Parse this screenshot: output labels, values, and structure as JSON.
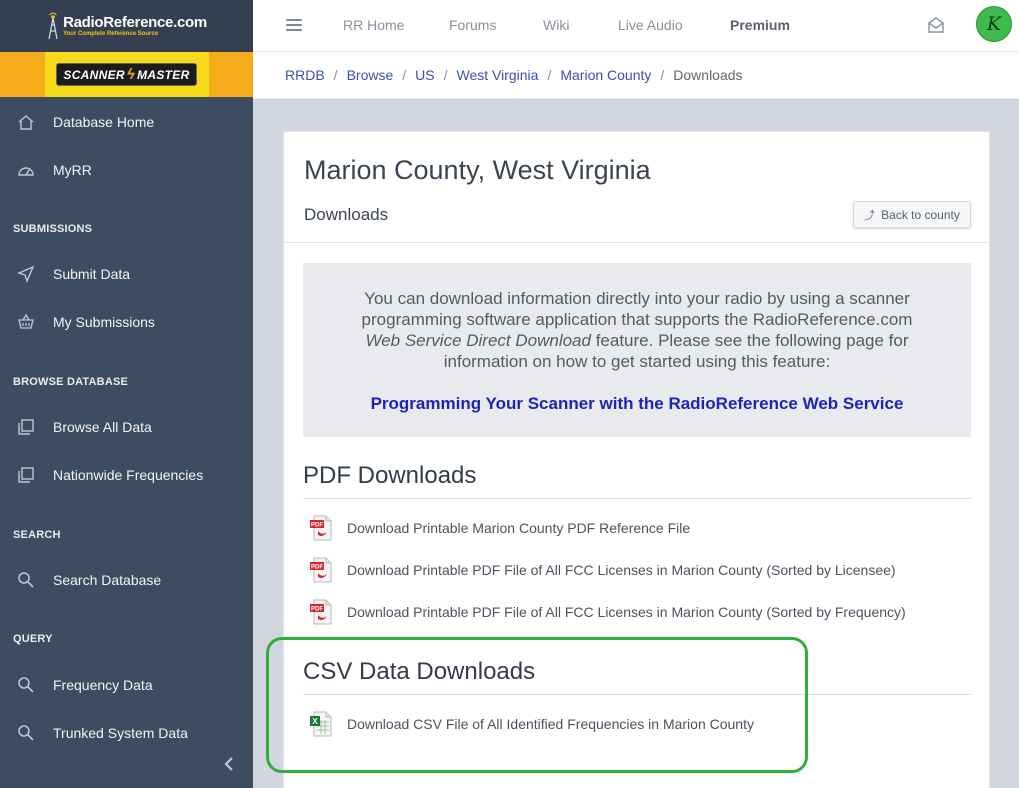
{
  "brand": {
    "name": "RadioReference.com",
    "tagline": "Your Complete Reference Source"
  },
  "sponsor": {
    "left": "SCANNER",
    "right": "MASTER"
  },
  "sidebar": {
    "items": [
      {
        "label": "Database Home",
        "icon": "home-icon"
      },
      {
        "label": "MyRR",
        "icon": "dashboard-icon"
      },
      {
        "label": "Submit Data",
        "icon": "send-icon"
      },
      {
        "label": "My Submissions",
        "icon": "basket-icon"
      },
      {
        "label": "Browse All Data",
        "icon": "copy-icon"
      },
      {
        "label": "Nationwide Frequencies",
        "icon": "copy-icon"
      },
      {
        "label": "Search Database",
        "icon": "search-icon"
      },
      {
        "label": "Frequency Data",
        "icon": "search-icon"
      },
      {
        "label": "Trunked System Data",
        "icon": "search-icon"
      }
    ],
    "sections": [
      "SUBMISSIONS",
      "BROWSE DATABASE",
      "SEARCH",
      "QUERY"
    ],
    "collapse_icon": "chevron-left-icon"
  },
  "topnav": {
    "items": [
      "RR Home",
      "Forums",
      "Wiki",
      "Live Audio",
      "Premium"
    ],
    "avatar_initial": "K"
  },
  "breadcrumb": [
    "RRDB",
    "Browse",
    "US",
    "West Virginia",
    "Marion County",
    "Downloads"
  ],
  "page": {
    "title": "Marion County, West Virginia",
    "subtitle": "Downloads",
    "back_label": "Back to county",
    "info_line1": "You can download information directly into your radio by using a scanner",
    "info_line2": "programming software application that supports the RadioReference.com",
    "info_line3_ital": "Web Service Direct Download",
    "info_line3_rest": " feature. Please see the following page for",
    "info_line4": "information on how to get started using this feature:",
    "info_link": "Programming Your Scanner with the RadioReference Web Service"
  },
  "pdf": {
    "title": "PDF Downloads",
    "items": [
      "Download Printable Marion County PDF Reference File",
      "Download Printable PDF File of All FCC Licenses in Marion County (Sorted by Licensee)",
      "Download Printable PDF File of All FCC Licenses in Marion County (Sorted by Frequency)"
    ]
  },
  "csv": {
    "title": "CSV Data Downloads",
    "items": [
      "Download CSV File of All Identified Frequencies in Marion County"
    ]
  },
  "colors": {
    "highlight": "#2fae3c",
    "link": "#3a4fb5",
    "sidebar": "#3e4c61",
    "avatar": "#3dbb4c"
  }
}
